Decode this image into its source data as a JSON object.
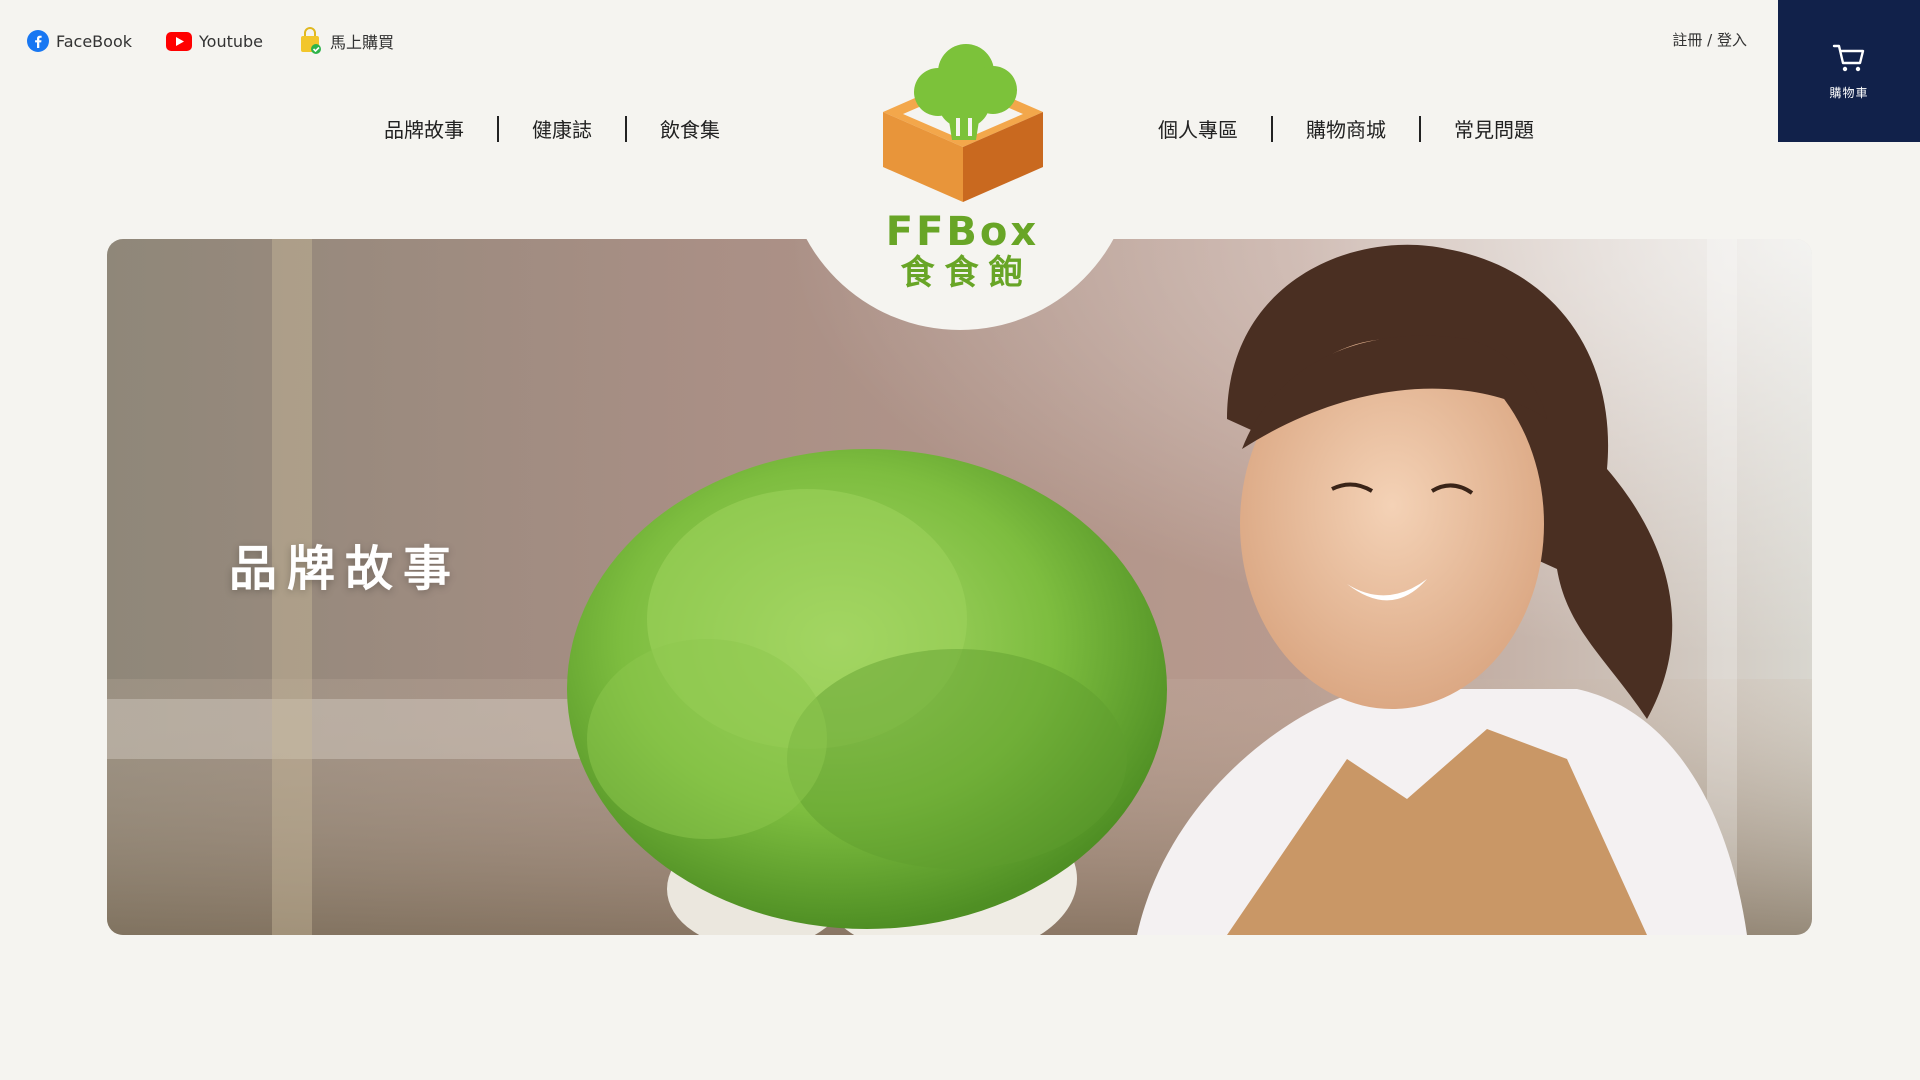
{
  "social": [
    {
      "label": "FaceBook",
      "icon": "facebook-icon"
    },
    {
      "label": "Youtube",
      "icon": "youtube-icon"
    },
    {
      "label": "馬上購買",
      "icon": "shopping-bag-icon"
    }
  ],
  "auth": {
    "label": "註冊 / 登入"
  },
  "cart": {
    "label": "購物車",
    "icon": "cart-icon"
  },
  "nav_left": [
    {
      "label": "品牌故事"
    },
    {
      "label": "健康誌"
    },
    {
      "label": "飲食集"
    }
  ],
  "nav_right": [
    {
      "label": "個人專區"
    },
    {
      "label": "購物商城"
    },
    {
      "label": "常見問題"
    }
  ],
  "logo": {
    "en": "FFBox",
    "zh": "食食飽"
  },
  "hero": {
    "title": "品牌故事"
  },
  "colors": {
    "background": "#f5f4f0",
    "cart_bg": "#11214a",
    "brand_green": "#68a526",
    "brand_orange": "#e8953a"
  }
}
